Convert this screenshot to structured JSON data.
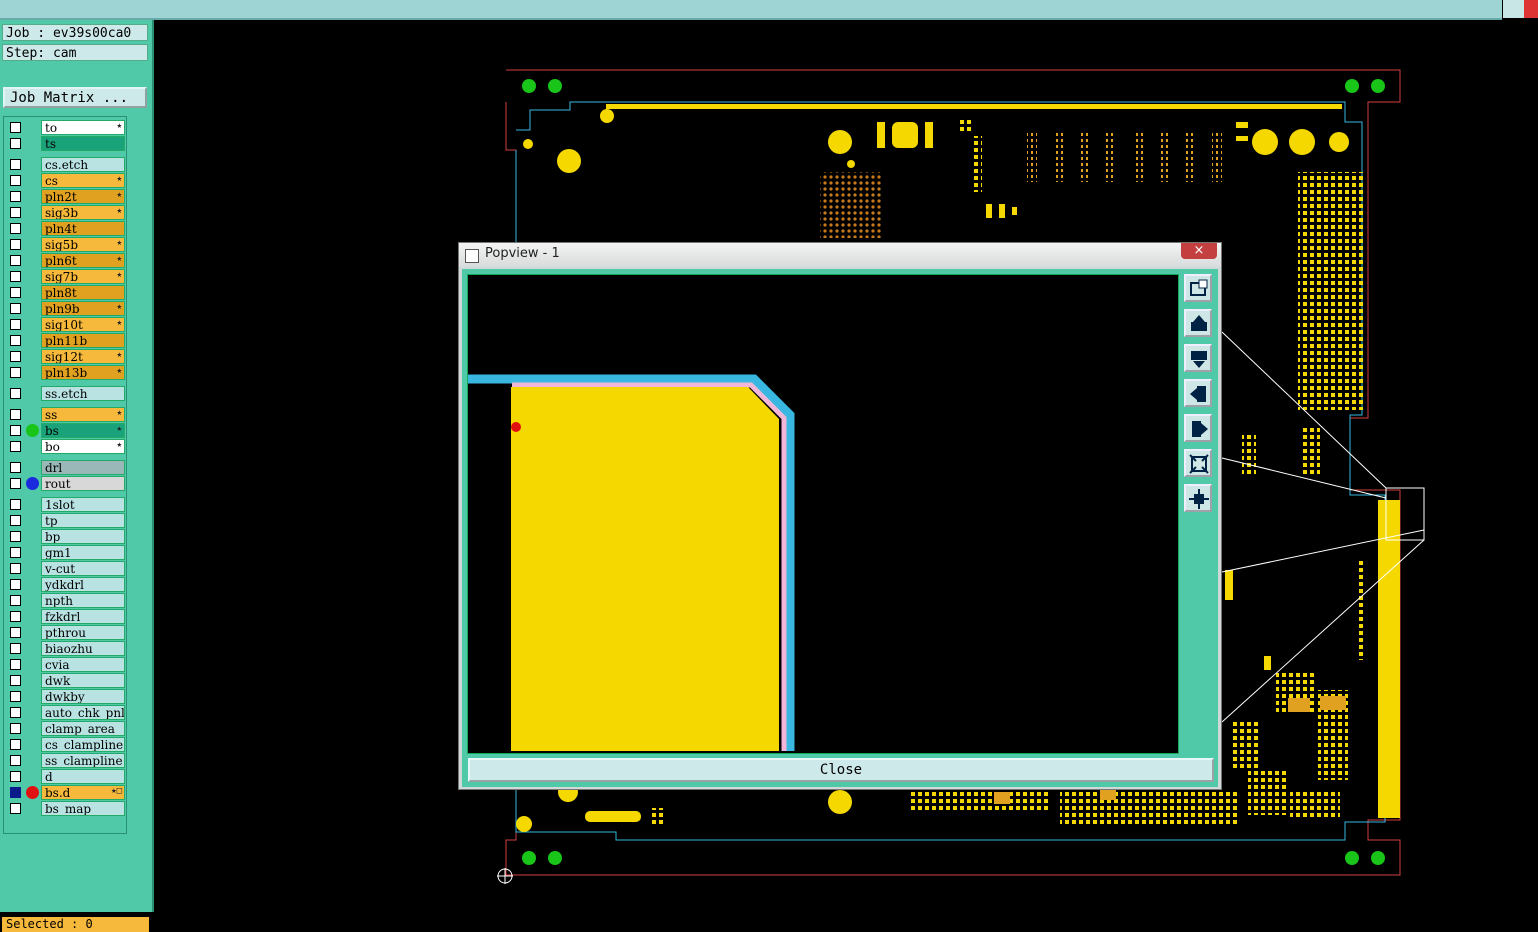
{
  "header": {
    "job": "Job : ev39s00ca0",
    "step": "Step: cam",
    "job_matrix": "Job Matrix ..."
  },
  "layers": [
    {
      "name": "to",
      "color": "#ffffff",
      "flag": "★"
    },
    {
      "name": "ts",
      "color": "#1aa37a",
      "flag": ""
    },
    {
      "name": "cs.etch",
      "color": "#b9e3e3",
      "flag": ""
    },
    {
      "name": "cs",
      "color": "#f6b93b",
      "flag": "★"
    },
    {
      "name": "pln2t",
      "color": "#e0a020",
      "flag": "★"
    },
    {
      "name": "sig3b",
      "color": "#f6b93b",
      "flag": "★"
    },
    {
      "name": "pln4t",
      "color": "#e0a020",
      "flag": ""
    },
    {
      "name": "sig5b",
      "color": "#f6b93b",
      "flag": "★"
    },
    {
      "name": "pln6t",
      "color": "#e0a020",
      "flag": "★"
    },
    {
      "name": "sig7b",
      "color": "#f6b93b",
      "flag": "★"
    },
    {
      "name": "pln8t",
      "color": "#e0a020",
      "flag": ""
    },
    {
      "name": "pln9b",
      "color": "#e0a020",
      "flag": "★"
    },
    {
      "name": "sig10t",
      "color": "#f6b93b",
      "flag": "★"
    },
    {
      "name": "pln11b",
      "color": "#e0a020",
      "flag": ""
    },
    {
      "name": "sig12t",
      "color": "#f6b93b",
      "flag": "★"
    },
    {
      "name": "pln13b",
      "color": "#e0a020",
      "flag": "★"
    },
    {
      "name": "ss.etch",
      "color": "#b9e3e3",
      "flag": ""
    },
    {
      "name": "ss",
      "color": "#f6b93b",
      "flag": "★"
    },
    {
      "name": "bs",
      "color": "#1aa37a",
      "flag": "★",
      "dot": "#18c518"
    },
    {
      "name": "bo",
      "color": "#ffffff",
      "flag": "★"
    },
    {
      "name": "drl",
      "color": "#9ab8b8",
      "flag": ""
    },
    {
      "name": "rout",
      "color": "#d8d8d8",
      "flag": "",
      "dot": "#1a2adc"
    },
    {
      "name": "1slot",
      "color": "#b9e3e3",
      "flag": ""
    },
    {
      "name": "tp",
      "color": "#b9e3e3",
      "flag": ""
    },
    {
      "name": "bp",
      "color": "#b9e3e3",
      "flag": ""
    },
    {
      "name": "gm1",
      "color": "#b9e3e3",
      "flag": ""
    },
    {
      "name": "v-cut",
      "color": "#b9e3e3",
      "flag": ""
    },
    {
      "name": "ydkdrl",
      "color": "#b9e3e3",
      "flag": ""
    },
    {
      "name": "npth",
      "color": "#b9e3e3",
      "flag": ""
    },
    {
      "name": "fzkdrl",
      "color": "#b9e3e3",
      "flag": ""
    },
    {
      "name": "pthrou",
      "color": "#b9e3e3",
      "flag": ""
    },
    {
      "name": "biaozhu",
      "color": "#b9e3e3",
      "flag": ""
    },
    {
      "name": "cvia",
      "color": "#b9e3e3",
      "flag": ""
    },
    {
      "name": "dwk",
      "color": "#b9e3e3",
      "flag": ""
    },
    {
      "name": "dwkby",
      "color": "#b9e3e3",
      "flag": ""
    },
    {
      "name": "auto_chk_pnl",
      "color": "#b9e3e3",
      "flag": ""
    },
    {
      "name": "clamp_area",
      "color": "#b9e3e3",
      "flag": ""
    },
    {
      "name": "cs_clampline",
      "color": "#b9e3e3",
      "flag": ""
    },
    {
      "name": "ss_clampline",
      "color": "#b9e3e3",
      "flag": ""
    },
    {
      "name": "d",
      "color": "#b9e3e3",
      "flag": ""
    },
    {
      "name": "bs.d",
      "color": "#f6b93b",
      "flag": "★□",
      "dot": "#e01010",
      "checked": true
    },
    {
      "name": "bs_map",
      "color": "#b9e3e3",
      "flag": ""
    }
  ],
  "status": {
    "selected": "Selected : 0"
  },
  "popview": {
    "title": "Popview - 1",
    "close_label": "Close",
    "close_x": "×"
  },
  "tools": [
    "zoom-window-icon",
    "pan-up-icon",
    "pan-down-icon",
    "pan-left-icon",
    "pan-right-icon",
    "zoom-out-icon",
    "zoom-in-icon"
  ],
  "colors": {
    "board_feature": "#f5d800",
    "outline": "#39b7e0",
    "panel_bg": "#4fc9a7"
  }
}
